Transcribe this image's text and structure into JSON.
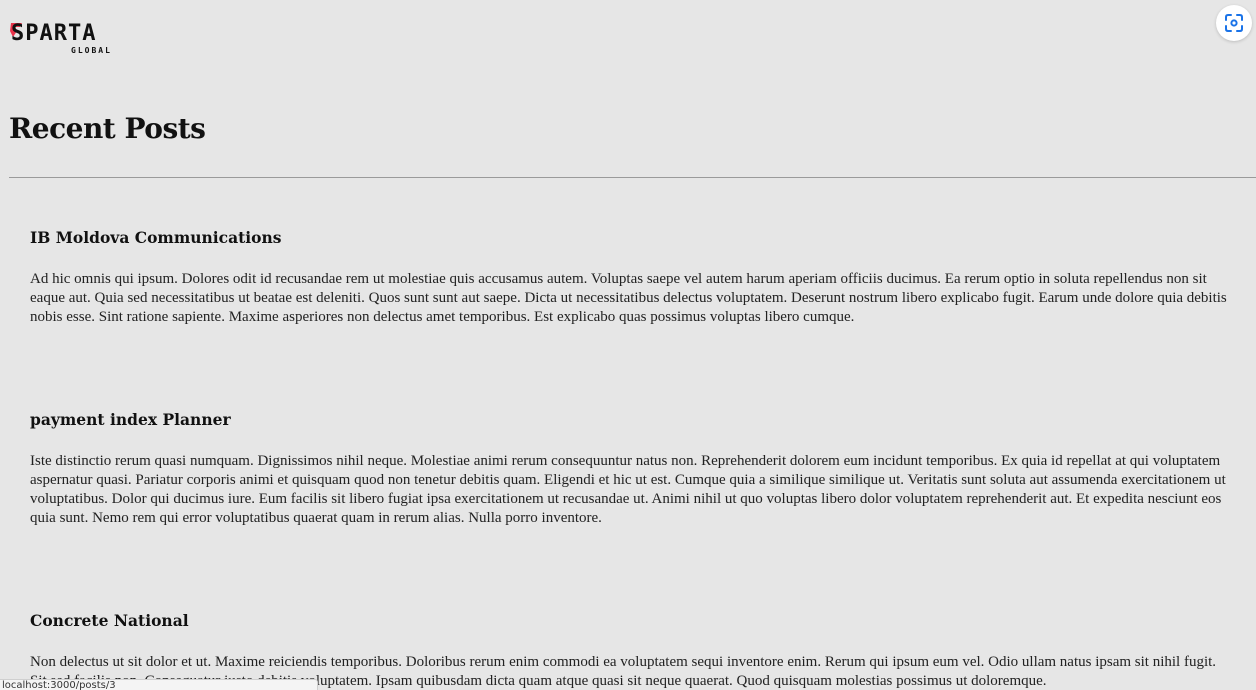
{
  "brand": {
    "logo_text": "SPARTA",
    "logo_subtext": "GLOBAL",
    "logo_accent_color": "#e8334a"
  },
  "toolbar": {
    "lens_icon": "screenshot-lens-icon"
  },
  "main": {
    "title": "Recent Posts",
    "posts": [
      {
        "title": "IB Moldova Communications",
        "body": "Ad hic omnis qui ipsum. Dolores odit id recusandae rem ut molestiae quis accusamus autem. Voluptas saepe vel autem harum aperiam officiis ducimus. Ea rerum optio in soluta repellendus non sit eaque aut. Quia sed necessitatibus ut beatae est deleniti. Quos sunt sunt aut saepe. Dicta ut necessitatibus delectus voluptatem. Deserunt nostrum libero explicabo fugit. Earum unde dolore quia debitis nobis esse. Sint ratione sapiente. Maxime asperiores non delectus amet temporibus. Est explicabo quas possimus voluptas libero cumque."
      },
      {
        "title": "payment index Planner",
        "body": "Iste distinctio rerum quasi numquam. Dignissimos nihil neque. Molestiae animi rerum consequuntur natus non. Reprehenderit dolorem eum incidunt temporibus. Ex quia id repellat at qui voluptatem aspernatur quasi. Pariatur corporis animi et quisquam quod non tenetur debitis quam. Eligendi et hic ut est. Cumque quia a similique similique ut. Veritatis sunt soluta aut assumenda exercitationem ut voluptatibus. Dolor qui ducimus iure. Eum facilis sit libero fugiat ipsa exercitationem ut recusandae ut. Animi nihil ut quo voluptas libero dolor voluptatem reprehenderit aut. Et expedita nesciunt eos quia sunt. Nemo rem qui error voluptatibus quaerat quam in rerum alias. Nulla porro inventore."
      },
      {
        "title": "Concrete National",
        "body": "Non delectus ut sit dolor et ut. Maxime reiciendis temporibus. Doloribus rerum enim commodi ea voluptatem sequi inventore enim. Rerum qui ipsum eum vel. Odio ullam natus ipsam sit nihil fugit. Sit sed facilis non. Consequatur iusto debitis voluptatem. Ipsam quibusdam dicta quam atque quasi sit neque quaerat. Quod quisquam molestias possimus ut doloremque."
      }
    ]
  },
  "status_bar": {
    "text": "localhost:3000/posts/3"
  }
}
